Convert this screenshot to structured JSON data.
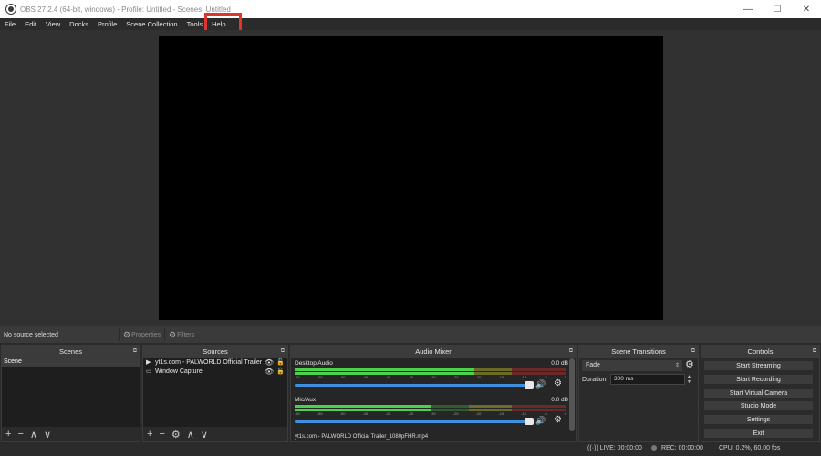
{
  "window": {
    "title": "OBS 27.2.4 (64-bit, windows) - Profile: Untitled - Scenes: Untitled",
    "controls": {
      "minimize": "—",
      "maximize": "☐",
      "close": "✕"
    }
  },
  "menu": [
    "File",
    "Edit",
    "View",
    "Docks",
    "Profile",
    "Scene Collection",
    "Tools",
    "Help"
  ],
  "highlight_color": "#e0352b",
  "source_toolbar": {
    "status": "No source selected",
    "properties_label": "Properties",
    "filters_label": "Filters"
  },
  "docks": {
    "scenes": {
      "title": "Scenes",
      "items": [
        "Scene"
      ],
      "tools": [
        "+",
        "−",
        "∧",
        "∨"
      ]
    },
    "sources": {
      "title": "Sources",
      "items": [
        {
          "name": "yt1s.com - PALWORLD Official Trailer",
          "icon": "play-icon"
        },
        {
          "name": "Window Capture",
          "icon": "window-icon"
        }
      ],
      "tools": [
        "+",
        "−",
        "⚙",
        "∧",
        "∨"
      ]
    },
    "audio_mixer": {
      "title": "Audio Mixer",
      "channels": [
        {
          "name": "Desktop Audio",
          "db": "0.0 dB",
          "level": 0.76
        },
        {
          "name": "Mic/Aux",
          "db": "0.0 dB",
          "level": 0.58
        }
      ],
      "ticks": [
        "-60",
        "-55",
        "-50",
        "-45",
        "-40",
        "-35",
        "-30",
        "-25",
        "-20",
        "-15",
        "-10",
        "-5",
        "0"
      ],
      "playing_track": "yt1s.com - PALWORLD Official Trailer_1080pFHR.mp4"
    },
    "scene_transitions": {
      "title": "Scene Transitions",
      "transition": "Fade",
      "duration_label": "Duration",
      "duration_value": "300 ms"
    },
    "controls": {
      "title": "Controls",
      "buttons": [
        "Start Streaming",
        "Start Recording",
        "Start Virtual Camera",
        "Studio Mode",
        "Settings",
        "Exit"
      ]
    }
  },
  "status": {
    "live": "LIVE: 00:00:00",
    "rec": "REC: 00:00:00",
    "cpu": "CPU: 0.2%, 60.00 fps"
  }
}
